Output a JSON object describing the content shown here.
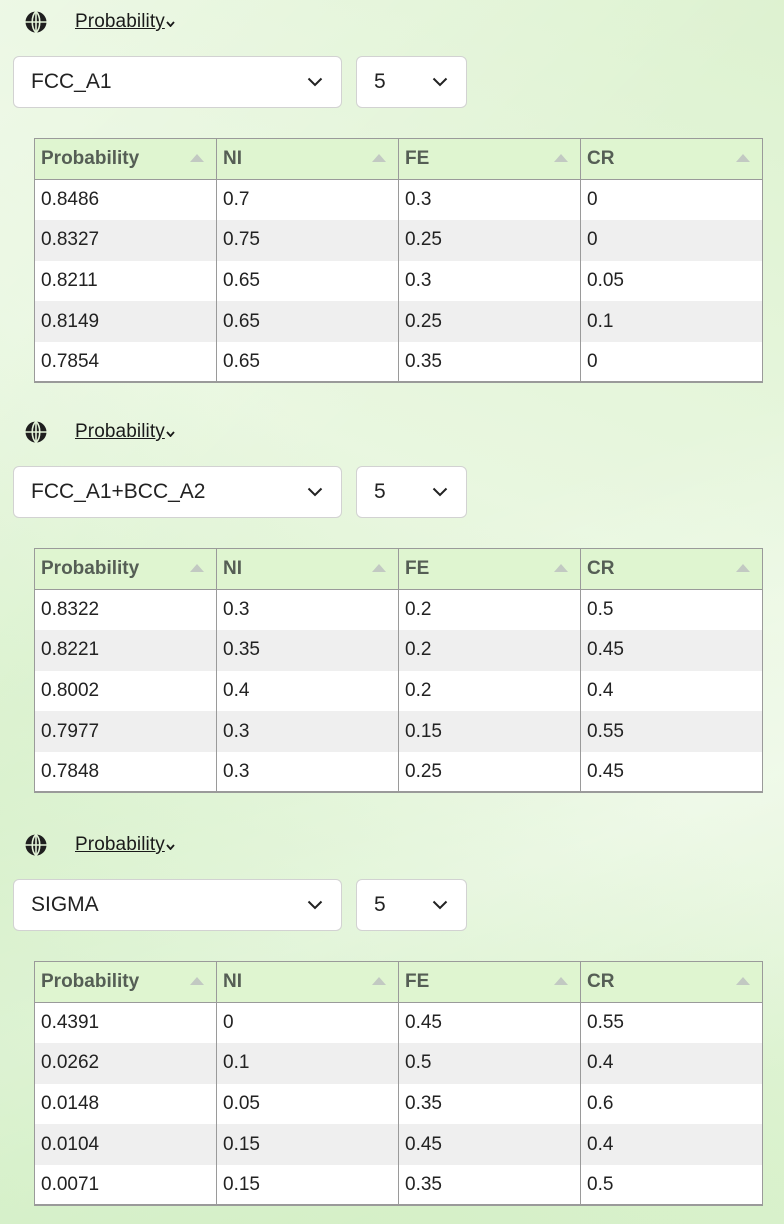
{
  "panels": [
    {
      "sort_label": "Probability",
      "phase_value": "FCC_A1",
      "count_value": "5",
      "columns": [
        "Probability",
        "NI",
        "FE",
        "CR"
      ],
      "rows": [
        [
          "0.8486",
          "0.7",
          "0.3",
          "0"
        ],
        [
          "0.8327",
          "0.75",
          "0.25",
          "0"
        ],
        [
          "0.8211",
          "0.65",
          "0.3",
          "0.05"
        ],
        [
          "0.8149",
          "0.65",
          "0.25",
          "0.1"
        ],
        [
          "0.7854",
          "0.65",
          "0.35",
          "0"
        ]
      ]
    },
    {
      "sort_label": "Probability",
      "phase_value": "FCC_A1+BCC_A2",
      "count_value": "5",
      "columns": [
        "Probability",
        "NI",
        "FE",
        "CR"
      ],
      "rows": [
        [
          "0.8322",
          "0.3",
          "0.2",
          "0.5"
        ],
        [
          "0.8221",
          "0.35",
          "0.2",
          "0.45"
        ],
        [
          "0.8002",
          "0.4",
          "0.2",
          "0.4"
        ],
        [
          "0.7977",
          "0.3",
          "0.15",
          "0.55"
        ],
        [
          "0.7848",
          "0.3",
          "0.25",
          "0.45"
        ]
      ]
    },
    {
      "sort_label": "Probability",
      "phase_value": "SIGMA",
      "count_value": "5",
      "columns": [
        "Probability",
        "NI",
        "FE",
        "CR"
      ],
      "rows": [
        [
          "0.4391",
          "0",
          "0.45",
          "0.55"
        ],
        [
          "0.0262",
          "0.1",
          "0.5",
          "0.4"
        ],
        [
          "0.0148",
          "0.05",
          "0.35",
          "0.6"
        ],
        [
          "0.0104",
          "0.15",
          "0.45",
          "0.4"
        ],
        [
          "0.0071",
          "0.15",
          "0.35",
          "0.5"
        ]
      ]
    }
  ],
  "icons": {
    "globe": "globe-icon",
    "sort_caret": "caret-down-icon",
    "select_chevron": "chevron-down-icon",
    "column_sort": "sort-ascending-icon"
  },
  "colors": {
    "header_bg": "#dff5d0",
    "stripe": "#efefef",
    "page_bg": "#e4f4d9"
  }
}
